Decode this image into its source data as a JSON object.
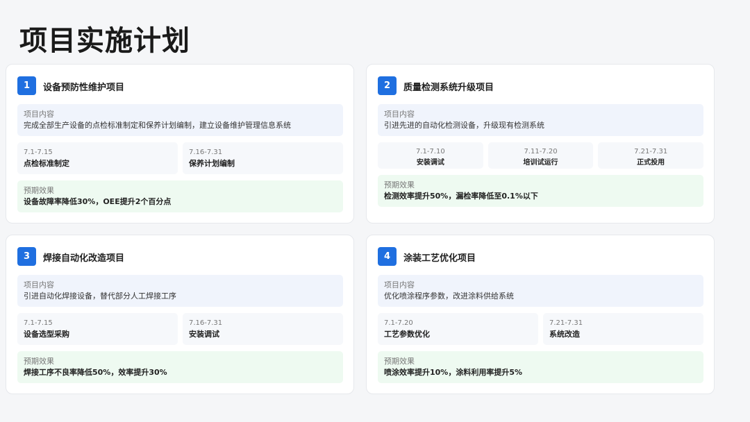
{
  "page_title": "项目实施计划",
  "content_label": "项目内容",
  "effect_label": "预期效果",
  "projects": [
    {
      "number": "1",
      "title": "设备预防性维护项目",
      "content": "完成全部生产设备的点检标准制定和保养计划编制，建立设备维护管理信息系统",
      "schedule": [
        {
          "date": "7.1-7.15",
          "task": "点检标准制定"
        },
        {
          "date": "7.16-7.31",
          "task": "保养计划编制"
        }
      ],
      "effect": "设备故障率降低30%，OEE提升2个百分点"
    },
    {
      "number": "2",
      "title": "质量检测系统升级项目",
      "content": "引进先进的自动化检测设备，升级现有检测系统",
      "schedule": [
        {
          "date": "7.1-7.10",
          "task": "安装调试"
        },
        {
          "date": "7.11-7.20",
          "task": "培训试运行"
        },
        {
          "date": "7.21-7.31",
          "task": "正式投用"
        }
      ],
      "effect": "检测效率提升50%，漏检率降低至0.1%以下"
    },
    {
      "number": "3",
      "title": "焊接自动化改造项目",
      "content": "引进自动化焊接设备，替代部分人工焊接工序",
      "schedule": [
        {
          "date": "7.1-7.15",
          "task": "设备选型采购"
        },
        {
          "date": "7.16-7.31",
          "task": "安装调试"
        }
      ],
      "effect": "焊接工序不良率降低50%，效率提升30%"
    },
    {
      "number": "4",
      "title": "涂装工艺优化项目",
      "content": "优化喷涂程序参数，改进涂料供给系统",
      "schedule": [
        {
          "date": "7.1-7.20",
          "task": "工艺参数优化"
        },
        {
          "date": "7.21-7.31",
          "task": "系统改造"
        }
      ],
      "effect": "喷涂效率提升10%，涂料利用率提升5%"
    }
  ]
}
